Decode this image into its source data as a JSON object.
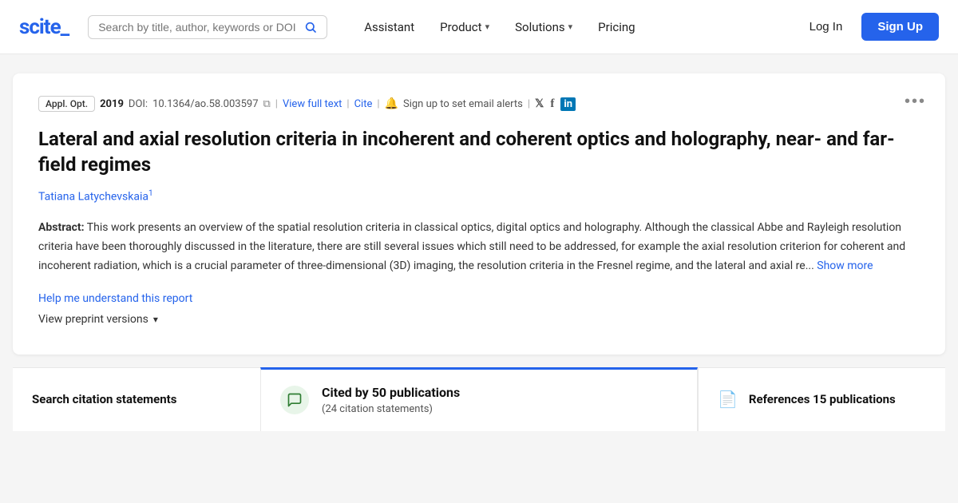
{
  "brand": {
    "name": "scite_",
    "name_prefix": "scite",
    "name_suffix": "_"
  },
  "navbar": {
    "search_placeholder": "Search by title, author, keywords or DOI",
    "links": [
      {
        "id": "assistant",
        "label": "Assistant",
        "has_dropdown": false
      },
      {
        "id": "product",
        "label": "Product",
        "has_dropdown": true
      },
      {
        "id": "solutions",
        "label": "Solutions",
        "has_dropdown": true
      },
      {
        "id": "pricing",
        "label": "Pricing",
        "has_dropdown": false
      }
    ],
    "login_label": "Log In",
    "signup_label": "Sign Up"
  },
  "paper": {
    "journal": "Appl. Opt.",
    "year": "2019",
    "doi_label": "DOI:",
    "doi": "10.1364/ao.58.003597",
    "view_full_text": "View full text",
    "cite": "Cite",
    "alert_text": "Sign up to set email alerts",
    "title": "Lateral and axial resolution criteria in incoherent and coherent optics and holography, near- and far-field regimes",
    "author": "Tatiana Latychevskaia",
    "author_sup": "1",
    "abstract_label": "Abstract:",
    "abstract_text": "This work presents an overview of the spatial resolution criteria in classical optics, digital optics and holography. Although the classical Abbe and Rayleigh resolution criteria have been thoroughly discussed in the literature, there are still several issues which still need to be addressed, for example the axial resolution criterion for coherent and incoherent radiation, which is a crucial parameter of three-dimensional (3D) imaging, the resolution criteria in the Fresnel regime, and the lateral and axial re...",
    "show_more": "Show more",
    "help_link": "Help me understand this report",
    "preprint_label": "View preprint versions"
  },
  "bottom": {
    "search_citations_label": "Search citation statements",
    "cited_by_title": "Cited by 50 publications",
    "cited_by_sub": "(24 citation statements)",
    "references_label": "References 15 publications"
  },
  "icons": {
    "search": "🔍",
    "bell": "🔔",
    "twitter": "𝕏",
    "facebook": "f",
    "linkedin": "in",
    "more": "•••",
    "chat_bubble": "💬",
    "document": "📄",
    "chevron_down": "▾"
  },
  "colors": {
    "accent": "#2563eb",
    "green": "#2e7d32",
    "green_bg": "#e8f5e9"
  }
}
